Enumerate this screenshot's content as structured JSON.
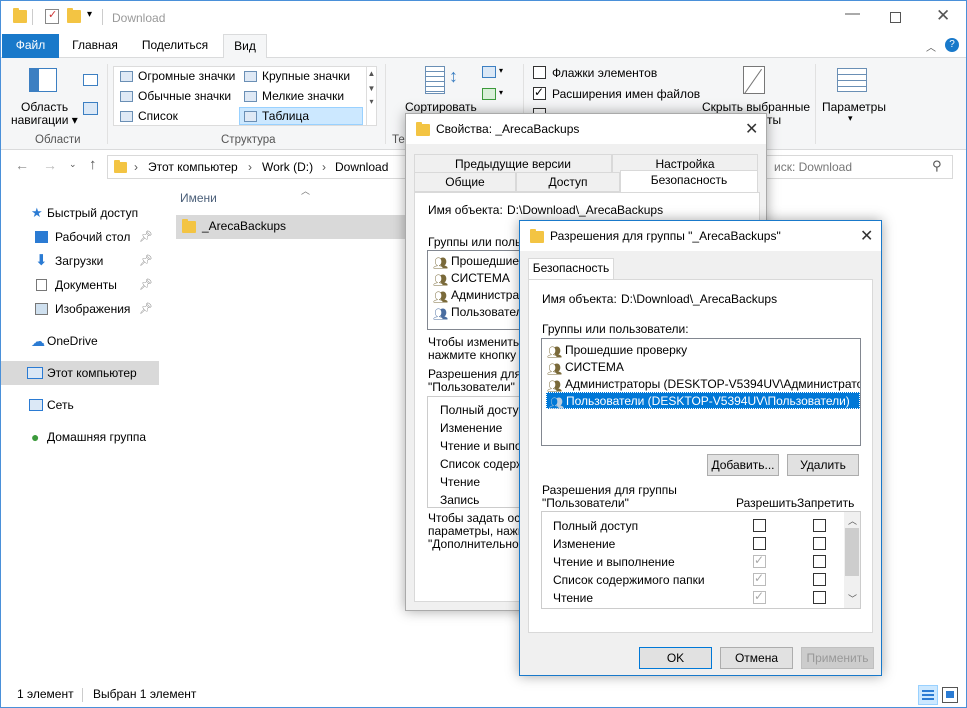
{
  "explorer": {
    "title": "Download",
    "tabs": [
      "Файл",
      "Главная",
      "Поделиться",
      "Вид"
    ],
    "ribbon": {
      "nav_pane_label_1": "Область",
      "nav_pane_label_2": "навигации",
      "group_panes": "Области",
      "layout_items": [
        "Огромные значки",
        "Крупные значки",
        "Обычные значки",
        "Мелкие значки",
        "Список",
        "Таблица"
      ],
      "group_layout": "Структура",
      "sort_label": "Сортировать",
      "group_view_partial": "Те",
      "checkboxes": [
        {
          "label": "Флажки элементов",
          "checked": false
        },
        {
          "label": "Расширения имен файлов",
          "checked": true
        }
      ],
      "hide_selected_1": "Скрыть выбранные",
      "hide_selected_2": "ты",
      "options_label": "Параметры"
    },
    "address": {
      "crumbs": [
        "Этот компьютер",
        "Work (D:)",
        "Download"
      ],
      "search_placeholder": "иск: Download"
    },
    "nav_pane": {
      "items": [
        {
          "label": "Быстрый доступ",
          "pinned": false
        },
        {
          "label": "Рабочий стол",
          "pinned": true
        },
        {
          "label": "Загрузки",
          "pinned": true
        },
        {
          "label": "Документы",
          "pinned": true
        },
        {
          "label": "Изображения",
          "pinned": true
        },
        {
          "label": "OneDrive",
          "pinned": false
        },
        {
          "label": "Этот компьютер",
          "pinned": false
        },
        {
          "label": "Сеть",
          "pinned": false
        },
        {
          "label": "Домашняя группа",
          "pinned": false
        }
      ]
    },
    "content": {
      "column_name": "Имени",
      "files": [
        "_ArecaBackups"
      ]
    },
    "status": {
      "count": "1 элемент",
      "selected": "Выбран 1 элемент"
    }
  },
  "props_dialog": {
    "title": "Свойства: _ArecaBackups",
    "tabs_row1": [
      "Предыдущие версии",
      "Настройка"
    ],
    "tabs_row2": [
      "Общие",
      "Доступ",
      "Безопасность"
    ],
    "object_label": "Имя объекта:",
    "object_value": "D:\\Download\\_ArecaBackups",
    "groups_label": "Группы или польз",
    "users": [
      "Прошедшие п",
      "СИСТЕМА",
      "Администрат",
      "Пользователи"
    ],
    "change_text_1": "Чтобы изменить р",
    "change_text_2": "нажмите кнопку \"",
    "perms_label_1": "Разрешения для г",
    "perms_label_2": "\"Пользователи\"",
    "perms": [
      "Полный доступ",
      "Изменение",
      "Чтение и выполн",
      "Список содерж",
      "Чтение",
      "Запись"
    ],
    "special_1": "Чтобы задать осо",
    "special_2": "параметры, нажм",
    "special_3": "\"Дополнительно\"."
  },
  "perm_dialog": {
    "title": "Разрешения для группы \"_ArecaBackups\"",
    "tab": "Безопасность",
    "object_label": "Имя объекта:",
    "object_value": "D:\\Download\\_ArecaBackups",
    "groups_label": "Группы или пользователи:",
    "users": [
      "Прошедшие проверку",
      "СИСТЕМА",
      "Администраторы (DESKTOP-V5394UV\\Администраторы)",
      "Пользователи (DESKTOP-V5394UV\\Пользователи)"
    ],
    "add_btn": "Добавить...",
    "remove_btn": "Удалить",
    "perms_label_1": "Разрешения для группы",
    "perms_label_2": "\"Пользователи\"",
    "allow_header": "Разрешить",
    "deny_header": "Запретить",
    "perms": [
      {
        "name": "Полный доступ",
        "allow": false,
        "allow_disabled": false,
        "deny": false
      },
      {
        "name": "Изменение",
        "allow": false,
        "allow_disabled": false,
        "deny": false
      },
      {
        "name": "Чтение и выполнение",
        "allow": true,
        "allow_disabled": true,
        "deny": false
      },
      {
        "name": "Список содержимого папки",
        "allow": true,
        "allow_disabled": true,
        "deny": false
      },
      {
        "name": "Чтение",
        "allow": true,
        "allow_disabled": true,
        "deny": false
      }
    ],
    "ok_btn": "OK",
    "cancel_btn": "Отмена",
    "apply_btn": "Применить"
  }
}
